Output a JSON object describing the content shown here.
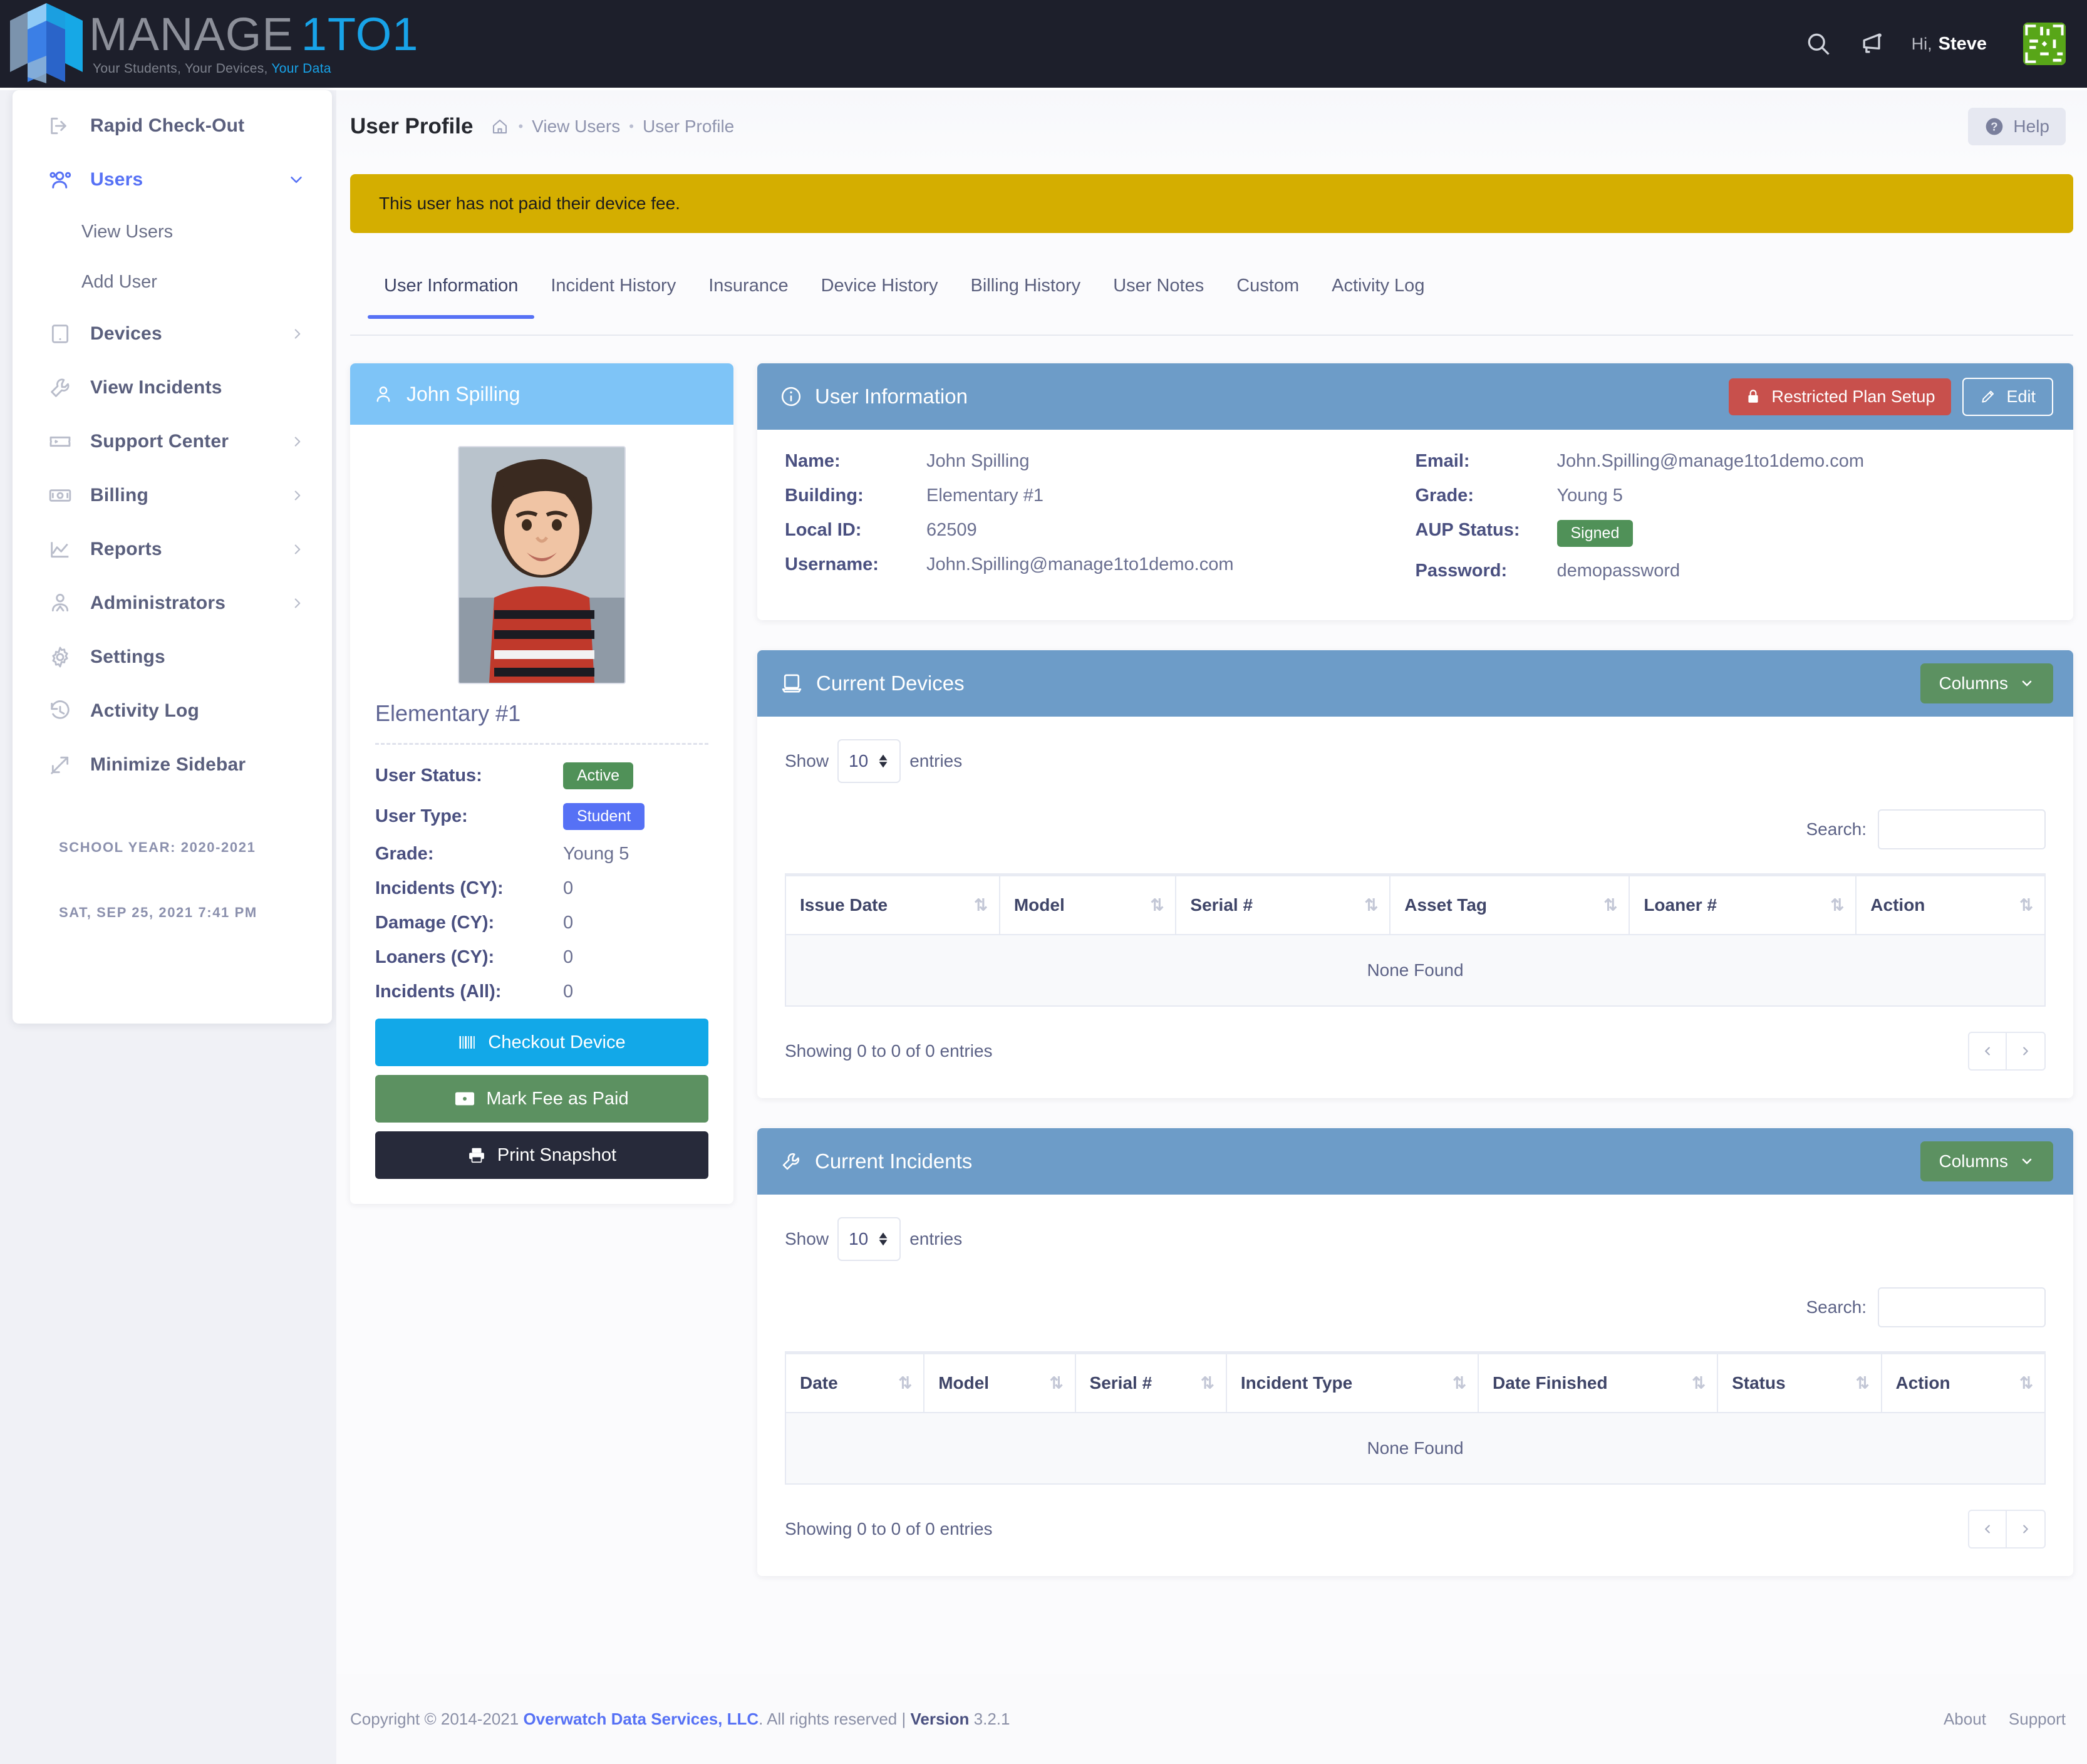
{
  "brand": {
    "name_part1": "MANAGE",
    "name_part2": "1TO1",
    "tagline_plain": "Your Students, Your Devices, ",
    "tagline_highlight": "Your Data"
  },
  "topbar": {
    "search_icon": "search-icon",
    "announce_icon": "megaphone-icon",
    "greeting": "Hi,",
    "user_name": "Steve"
  },
  "sidebar": {
    "items": [
      {
        "label": "Rapid Check-Out",
        "icon": "logout-icon",
        "caret": "",
        "active": false
      },
      {
        "label": "Users",
        "icon": "users-icon",
        "caret": "chevron-down-icon",
        "active": true
      },
      {
        "label": "Devices",
        "icon": "tablet-icon",
        "caret": "chevron-right-icon",
        "active": false
      },
      {
        "label": "View Incidents",
        "icon": "wrench-icon",
        "caret": "",
        "active": false
      },
      {
        "label": "Support Center",
        "icon": "ticket-icon",
        "caret": "chevron-right-icon",
        "active": false
      },
      {
        "label": "Billing",
        "icon": "money-icon",
        "caret": "chevron-right-icon",
        "active": false
      },
      {
        "label": "Reports",
        "icon": "chart-icon",
        "caret": "chevron-right-icon",
        "active": false
      },
      {
        "label": "Administrators",
        "icon": "admin-icon",
        "caret": "chevron-right-icon",
        "active": false
      },
      {
        "label": "Settings",
        "icon": "gear-icon",
        "caret": "",
        "active": false
      },
      {
        "label": "Activity Log",
        "icon": "history-icon",
        "caret": "",
        "active": false
      },
      {
        "label": "Minimize Sidebar",
        "icon": "minimize-icon",
        "caret": "",
        "active": false
      }
    ],
    "sub_items": [
      {
        "label": "View Users"
      },
      {
        "label": "Add User"
      }
    ],
    "school_year": "SCHOOL YEAR: 2020-2021",
    "datetime": "SAT, SEP 25, 2021 7:41 PM"
  },
  "page": {
    "title": "User Profile",
    "breadcrumb": [
      {
        "label": "home-icon",
        "type": "icon"
      },
      {
        "label": "View Users",
        "type": "link"
      },
      {
        "label": "User Profile",
        "type": "link"
      }
    ],
    "help_label": "Help",
    "alert_text": "This user has not paid their device fee."
  },
  "tabs": [
    {
      "label": "User Information",
      "active": true
    },
    {
      "label": "Incident History",
      "active": false
    },
    {
      "label": "Insurance",
      "active": false
    },
    {
      "label": "Device History",
      "active": false
    },
    {
      "label": "Billing History",
      "active": false
    },
    {
      "label": "User Notes",
      "active": false
    },
    {
      "label": "Custom",
      "active": false
    },
    {
      "label": "Activity Log",
      "active": false
    }
  ],
  "profile_card": {
    "header_name": "John Spilling",
    "building": "Elementary #1",
    "fields": [
      {
        "key": "User Status:",
        "value": "Active",
        "badge": "green"
      },
      {
        "key": "User Type:",
        "value": "Student",
        "badge": "blue"
      },
      {
        "key": "Grade:",
        "value": "Young 5",
        "badge": ""
      },
      {
        "key": "Incidents (CY):",
        "value": "0",
        "badge": ""
      },
      {
        "key": "Damage (CY):",
        "value": "0",
        "badge": ""
      },
      {
        "key": "Loaners (CY):",
        "value": "0",
        "badge": ""
      },
      {
        "key": "Incidents (All):",
        "value": "0",
        "badge": ""
      }
    ],
    "buttons": [
      {
        "label": "Checkout Device",
        "style": "cyan",
        "icon": "barcode-icon"
      },
      {
        "label": "Mark Fee as Paid",
        "style": "green",
        "icon": "money-icon"
      },
      {
        "label": "Print Snapshot",
        "style": "dark",
        "icon": "printer-icon"
      }
    ]
  },
  "user_information": {
    "panel_title": "User Information",
    "restricted_button": "Restricted Plan Setup",
    "edit_button": "Edit",
    "left_fields": [
      {
        "key": "Name:",
        "value": "John Spilling"
      },
      {
        "key": "Building:",
        "value": "Elementary #1"
      },
      {
        "key": "Local ID:",
        "value": "62509"
      },
      {
        "key": "Username:",
        "value": "John.Spilling@manage1to1demo.com"
      }
    ],
    "right_fields": [
      {
        "key": "Email:",
        "value": "John.Spilling@manage1to1demo.com",
        "badge": ""
      },
      {
        "key": "Grade:",
        "value": "Young 5",
        "badge": ""
      },
      {
        "key": "AUP Status:",
        "value": "Signed",
        "badge": "green"
      },
      {
        "key": "Password:",
        "value": "demopassword",
        "badge": ""
      }
    ]
  },
  "current_devices": {
    "panel_title": "Current Devices",
    "columns_button": "Columns",
    "show_label": "Show",
    "entries_label": "entries",
    "page_size": "10",
    "search_label": "Search:",
    "search_value": "",
    "headers": [
      "Issue Date",
      "Model",
      "Serial #",
      "Asset Tag",
      "Loaner #",
      "Action"
    ],
    "empty_text": "None Found",
    "info_text": "Showing 0 to 0 of 0 entries",
    "prev_icon": "chevron-left-icon",
    "next_icon": "chevron-right-icon"
  },
  "current_incidents": {
    "panel_title": "Current Incidents",
    "columns_button": "Columns",
    "show_label": "Show",
    "entries_label": "entries",
    "page_size": "10",
    "search_label": "Search:",
    "search_value": "",
    "headers": [
      "Date",
      "Model",
      "Serial #",
      "Incident Type",
      "Date Finished",
      "Status",
      "Action"
    ],
    "empty_text": "None Found",
    "info_text": "Showing 0 to 0 of 0 entries",
    "prev_icon": "chevron-left-icon",
    "next_icon": "chevron-right-icon"
  },
  "footer": {
    "copyright_pre": "Copyright © 2014-2021 ",
    "company": "Overwatch Data Services, LLC",
    "copyright_post": ". All rights reserved | ",
    "version_label": "Version",
    "version_number": "3.2.1",
    "links": [
      "About",
      "Support"
    ]
  },
  "colors": {
    "topbar": "#1d1f2b",
    "accent_blue": "#5671f5",
    "brand_cyan": "#18a3e8",
    "alert_yellow": "#d4ae00",
    "panel_header_blue": "#6d9cc8",
    "profile_header_blue": "#7ec4f7",
    "green": "#5c9161",
    "red": "#c8504c"
  }
}
